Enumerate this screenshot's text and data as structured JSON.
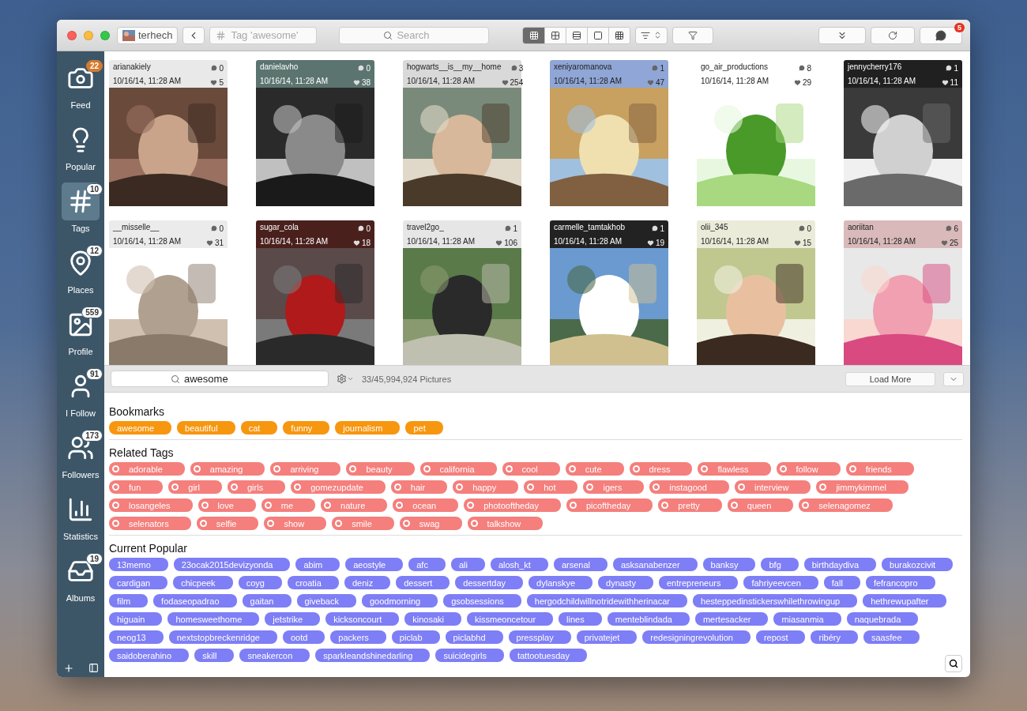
{
  "toolbar": {
    "account": "terhech",
    "tag_field": {
      "placeholder": "Tag 'awesome'"
    },
    "search": {
      "placeholder": "Search"
    },
    "views": [
      {
        "kind": "grid-small",
        "selected": true
      },
      {
        "kind": "grid",
        "selected": false
      },
      {
        "kind": "list",
        "selected": false
      },
      {
        "kind": "single",
        "selected": false
      },
      {
        "kind": "table",
        "selected": false
      }
    ],
    "messages_badge": "5"
  },
  "sidebar": {
    "items": [
      {
        "kind": "feed",
        "label": "Feed",
        "badge": "22",
        "highlight": true,
        "selected": false
      },
      {
        "kind": "popular",
        "label": "Popular",
        "selected": false
      },
      {
        "kind": "tags",
        "label": "Tags",
        "badge": "10",
        "highlight": false,
        "selected": true
      },
      {
        "kind": "places",
        "label": "Places",
        "badge": "12",
        "highlight": false,
        "selected": false
      },
      {
        "kind": "profile",
        "label": "Profile",
        "badge": "559",
        "highlight": false,
        "selected": false
      },
      {
        "kind": "follow",
        "label": "I Follow",
        "badge": "91",
        "highlight": false,
        "selected": false
      },
      {
        "kind": "followers",
        "label": "Followers",
        "badge": "173",
        "highlight": false,
        "selected": false
      },
      {
        "kind": "statistics",
        "label": "Statistics",
        "selected": false
      },
      {
        "kind": "albums",
        "label": "Albums",
        "badge": "19",
        "highlight": false,
        "selected": false
      }
    ]
  },
  "photos": [
    {
      "user": "arianakiely",
      "date": "10/16/14, 11:28 AM",
      "comments": "0",
      "likes": "5",
      "color": "#e9e9e9"
    },
    {
      "user": "danielavho",
      "date": "10/16/14, 11:28 AM",
      "comments": "0",
      "likes": "38",
      "color": "#5b746f"
    },
    {
      "user": "hogwarts__is__my__home",
      "date": "10/16/14, 11:28 AM",
      "comments": "3",
      "likes": "254",
      "color": "#d9d9d9"
    },
    {
      "user": "xeniyaromanova",
      "date": "10/16/14, 11:28 AM",
      "comments": "1",
      "likes": "47",
      "color": "#8fa6d6"
    },
    {
      "user": "go_air_productions",
      "date": "10/16/14, 11:28 AM",
      "comments": "8",
      "likes": "29",
      "color": "#ffffff"
    },
    {
      "user": "jennycherry176",
      "date": "10/16/14, 11:28 AM",
      "comments": "1",
      "likes": "11",
      "color": "#202020"
    },
    {
      "user": "__misselle__",
      "date": "10/16/14, 11:28 AM",
      "comments": "0",
      "likes": "31",
      "color": "#ebebeb"
    },
    {
      "user": "sugar_cola",
      "date": "10/16/14, 11:28 AM",
      "comments": "0",
      "likes": "18",
      "color": "#4a201d"
    },
    {
      "user": "travel2go_",
      "date": "10/16/14, 11:28 AM",
      "comments": "1",
      "likes": "106",
      "color": "#e6e6e6"
    },
    {
      "user": "carmelle_tamtakhob",
      "date": "10/16/14, 11:28 AM",
      "comments": "1",
      "likes": "19",
      "color": "#222222"
    },
    {
      "user": "olii_345",
      "date": "10/16/14, 11:28 AM",
      "comments": "0",
      "likes": "15",
      "color": "#ebebd9"
    },
    {
      "user": "aoriitan",
      "date": "10/16/14, 11:28 AM",
      "comments": "6",
      "likes": "25",
      "color": "#d9b9b9"
    }
  ],
  "filter_bar": {
    "search": {
      "value": "awesome"
    },
    "count": "33/45,994,924 Pictures",
    "load_more": "Load More"
  },
  "sections": [
    {
      "kind": "bookmarks",
      "title": "Bookmarks",
      "tags": [
        "awesome",
        "beautiful",
        "cat",
        "funny",
        "journalism",
        "pet"
      ]
    },
    {
      "kind": "related",
      "title": "Related Tags",
      "tags": [
        "adorable",
        "amazing",
        "arriving",
        "beauty",
        "california",
        "cool",
        "cute",
        "dress",
        "flawless",
        "follow",
        "friends",
        "fun",
        "girl",
        "girls",
        "gomezupdate",
        "hair",
        "happy",
        "hot",
        "igers",
        "instagood",
        "interview",
        "jimmykimmel",
        "losangeles",
        "love",
        "me",
        "nature",
        "ocean",
        "photooftheday",
        "picoftheday",
        "pretty",
        "queen",
        "selenagomez",
        "selenators",
        "selfie",
        "show",
        "smile",
        "swag",
        "talkshow"
      ]
    },
    {
      "kind": "popular",
      "title": "Current Popular",
      "tags": [
        "13memo",
        "23ocak2015devizyonda",
        "abim",
        "aeostyle",
        "afc",
        "ali",
        "alosh_kt",
        "arsenal",
        "asksanabenzer",
        "banksy",
        "bfg",
        "birthdaydiva",
        "burakozcivit",
        "cardigan",
        "chicpeek",
        "coyg",
        "croatia",
        "deniz",
        "dessert",
        "dessertday",
        "dylanskye",
        "dynasty",
        "entrepreneurs",
        "fahriyeevcen",
        "fall",
        "fefrancopro",
        "film",
        "fodaseopadrao",
        "gaitan",
        "giveback",
        "goodmorning",
        "gsobsessions",
        "hergodchildwillnotridewithherinacar",
        "hesteppedinstickerswhilethrowingup",
        "hethrewupafter",
        "higuain",
        "homesweethome",
        "jetstrike",
        "kicksoncourt",
        "kinosaki",
        "kissmeoncetour",
        "lines",
        "menteblindada",
        "mertesacker",
        "miasanmia",
        "naquebrada",
        "neog13",
        "nextstopbreckenridge",
        "ootd",
        "packers",
        "piclab",
        "piclabhd",
        "pressplay",
        "privatejet",
        "redesigningrevolution",
        "repost",
        "ribéry",
        "saasfee",
        "saidoberahino",
        "skill",
        "sneakercon",
        "sparkleandshinedarling",
        "suicidegirls",
        "tattootuesday"
      ]
    }
  ]
}
